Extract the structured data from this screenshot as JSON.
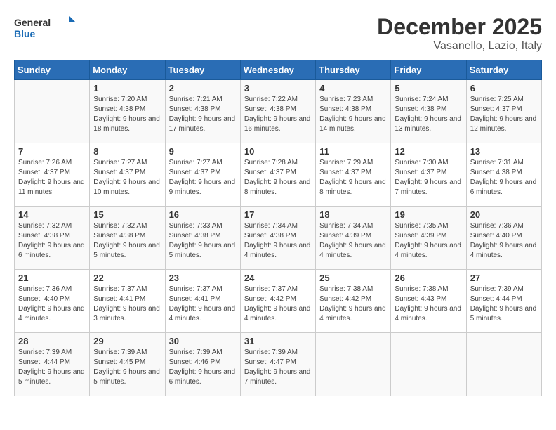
{
  "header": {
    "logo_general": "General",
    "logo_blue": "Blue",
    "month_year": "December 2025",
    "location": "Vasanello, Lazio, Italy"
  },
  "days_of_week": [
    "Sunday",
    "Monday",
    "Tuesday",
    "Wednesday",
    "Thursday",
    "Friday",
    "Saturday"
  ],
  "weeks": [
    [
      {
        "day": "",
        "sunrise": "",
        "sunset": "",
        "daylight": ""
      },
      {
        "day": "1",
        "sunrise": "Sunrise: 7:20 AM",
        "sunset": "Sunset: 4:38 PM",
        "daylight": "Daylight: 9 hours and 18 minutes."
      },
      {
        "day": "2",
        "sunrise": "Sunrise: 7:21 AM",
        "sunset": "Sunset: 4:38 PM",
        "daylight": "Daylight: 9 hours and 17 minutes."
      },
      {
        "day": "3",
        "sunrise": "Sunrise: 7:22 AM",
        "sunset": "Sunset: 4:38 PM",
        "daylight": "Daylight: 9 hours and 16 minutes."
      },
      {
        "day": "4",
        "sunrise": "Sunrise: 7:23 AM",
        "sunset": "Sunset: 4:38 PM",
        "daylight": "Daylight: 9 hours and 14 minutes."
      },
      {
        "day": "5",
        "sunrise": "Sunrise: 7:24 AM",
        "sunset": "Sunset: 4:38 PM",
        "daylight": "Daylight: 9 hours and 13 minutes."
      },
      {
        "day": "6",
        "sunrise": "Sunrise: 7:25 AM",
        "sunset": "Sunset: 4:37 PM",
        "daylight": "Daylight: 9 hours and 12 minutes."
      }
    ],
    [
      {
        "day": "7",
        "sunrise": "Sunrise: 7:26 AM",
        "sunset": "Sunset: 4:37 PM",
        "daylight": "Daylight: 9 hours and 11 minutes."
      },
      {
        "day": "8",
        "sunrise": "Sunrise: 7:27 AM",
        "sunset": "Sunset: 4:37 PM",
        "daylight": "Daylight: 9 hours and 10 minutes."
      },
      {
        "day": "9",
        "sunrise": "Sunrise: 7:27 AM",
        "sunset": "Sunset: 4:37 PM",
        "daylight": "Daylight: 9 hours and 9 minutes."
      },
      {
        "day": "10",
        "sunrise": "Sunrise: 7:28 AM",
        "sunset": "Sunset: 4:37 PM",
        "daylight": "Daylight: 9 hours and 8 minutes."
      },
      {
        "day": "11",
        "sunrise": "Sunrise: 7:29 AM",
        "sunset": "Sunset: 4:37 PM",
        "daylight": "Daylight: 9 hours and 8 minutes."
      },
      {
        "day": "12",
        "sunrise": "Sunrise: 7:30 AM",
        "sunset": "Sunset: 4:37 PM",
        "daylight": "Daylight: 9 hours and 7 minutes."
      },
      {
        "day": "13",
        "sunrise": "Sunrise: 7:31 AM",
        "sunset": "Sunset: 4:38 PM",
        "daylight": "Daylight: 9 hours and 6 minutes."
      }
    ],
    [
      {
        "day": "14",
        "sunrise": "Sunrise: 7:32 AM",
        "sunset": "Sunset: 4:38 PM",
        "daylight": "Daylight: 9 hours and 6 minutes."
      },
      {
        "day": "15",
        "sunrise": "Sunrise: 7:32 AM",
        "sunset": "Sunset: 4:38 PM",
        "daylight": "Daylight: 9 hours and 5 minutes."
      },
      {
        "day": "16",
        "sunrise": "Sunrise: 7:33 AM",
        "sunset": "Sunset: 4:38 PM",
        "daylight": "Daylight: 9 hours and 5 minutes."
      },
      {
        "day": "17",
        "sunrise": "Sunrise: 7:34 AM",
        "sunset": "Sunset: 4:38 PM",
        "daylight": "Daylight: 9 hours and 4 minutes."
      },
      {
        "day": "18",
        "sunrise": "Sunrise: 7:34 AM",
        "sunset": "Sunset: 4:39 PM",
        "daylight": "Daylight: 9 hours and 4 minutes."
      },
      {
        "day": "19",
        "sunrise": "Sunrise: 7:35 AM",
        "sunset": "Sunset: 4:39 PM",
        "daylight": "Daylight: 9 hours and 4 minutes."
      },
      {
        "day": "20",
        "sunrise": "Sunrise: 7:36 AM",
        "sunset": "Sunset: 4:40 PM",
        "daylight": "Daylight: 9 hours and 4 minutes."
      }
    ],
    [
      {
        "day": "21",
        "sunrise": "Sunrise: 7:36 AM",
        "sunset": "Sunset: 4:40 PM",
        "daylight": "Daylight: 9 hours and 4 minutes."
      },
      {
        "day": "22",
        "sunrise": "Sunrise: 7:37 AM",
        "sunset": "Sunset: 4:41 PM",
        "daylight": "Daylight: 9 hours and 3 minutes."
      },
      {
        "day": "23",
        "sunrise": "Sunrise: 7:37 AM",
        "sunset": "Sunset: 4:41 PM",
        "daylight": "Daylight: 9 hours and 4 minutes."
      },
      {
        "day": "24",
        "sunrise": "Sunrise: 7:37 AM",
        "sunset": "Sunset: 4:42 PM",
        "daylight": "Daylight: 9 hours and 4 minutes."
      },
      {
        "day": "25",
        "sunrise": "Sunrise: 7:38 AM",
        "sunset": "Sunset: 4:42 PM",
        "daylight": "Daylight: 9 hours and 4 minutes."
      },
      {
        "day": "26",
        "sunrise": "Sunrise: 7:38 AM",
        "sunset": "Sunset: 4:43 PM",
        "daylight": "Daylight: 9 hours and 4 minutes."
      },
      {
        "day": "27",
        "sunrise": "Sunrise: 7:39 AM",
        "sunset": "Sunset: 4:44 PM",
        "daylight": "Daylight: 9 hours and 5 minutes."
      }
    ],
    [
      {
        "day": "28",
        "sunrise": "Sunrise: 7:39 AM",
        "sunset": "Sunset: 4:44 PM",
        "daylight": "Daylight: 9 hours and 5 minutes."
      },
      {
        "day": "29",
        "sunrise": "Sunrise: 7:39 AM",
        "sunset": "Sunset: 4:45 PM",
        "daylight": "Daylight: 9 hours and 5 minutes."
      },
      {
        "day": "30",
        "sunrise": "Sunrise: 7:39 AM",
        "sunset": "Sunset: 4:46 PM",
        "daylight": "Daylight: 9 hours and 6 minutes."
      },
      {
        "day": "31",
        "sunrise": "Sunrise: 7:39 AM",
        "sunset": "Sunset: 4:47 PM",
        "daylight": "Daylight: 9 hours and 7 minutes."
      },
      {
        "day": "",
        "sunrise": "",
        "sunset": "",
        "daylight": ""
      },
      {
        "day": "",
        "sunrise": "",
        "sunset": "",
        "daylight": ""
      },
      {
        "day": "",
        "sunrise": "",
        "sunset": "",
        "daylight": ""
      }
    ]
  ]
}
